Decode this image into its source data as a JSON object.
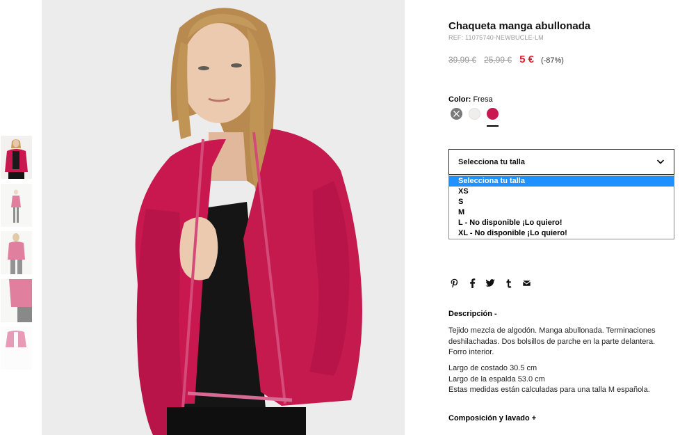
{
  "product": {
    "title": "Chaqueta manga abullonada",
    "ref": "REF: 11075740-NEWBUCLE-LM",
    "prices": {
      "original": "39,99 €",
      "previous": "25,99 €",
      "sale": "5 €",
      "discount": "(-87%)"
    }
  },
  "color": {
    "label": "Color:",
    "value": "Fresa",
    "swatches": [
      "#7a7a7a",
      "#f0eeec",
      "#c8184f"
    ],
    "selected_index": 2
  },
  "size": {
    "placeholder": "Selecciona tu talla",
    "options": [
      "Selecciona tu talla",
      "XS",
      "S",
      "M",
      "L - No disponible ¡Lo quiero!",
      "XL - No disponible ¡Lo quiero!"
    ]
  },
  "social": [
    "pinterest-icon",
    "facebook-icon",
    "twitter-icon",
    "tumblr-icon",
    "email-icon"
  ],
  "description": {
    "heading": "Descripción -",
    "text": "Tejido mezcla de algodón. Manga abullonada. Terminaciones deshilachadas. Dos bolsillos de parche en la parte delantera. Forro interior.",
    "measure_1": "Largo de costado 30.5 cm",
    "measure_2": "Largo de la espalda 53.0 cm",
    "measure_3": "Estas medidas están calculadas para una talla M española."
  },
  "composition": {
    "heading": "Composición y lavado +"
  },
  "colors": {
    "sale": "#e01e2f",
    "jacket": "#c8184f",
    "highlight": "#1e90ff"
  }
}
